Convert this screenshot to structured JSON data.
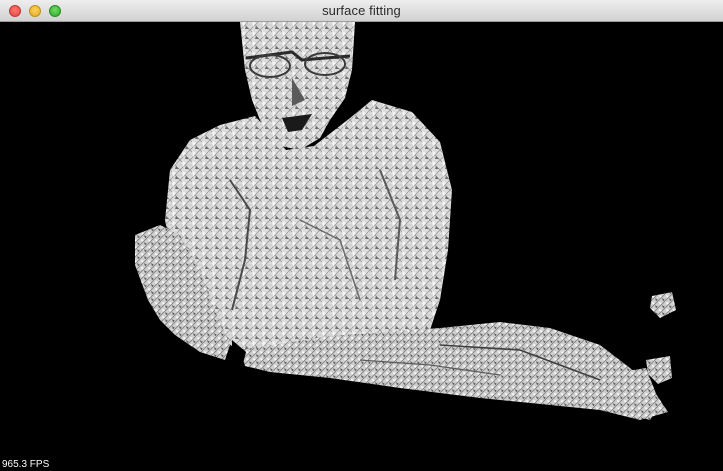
{
  "window": {
    "title": "surface fitting",
    "controls": [
      "close",
      "minimize",
      "zoom"
    ]
  },
  "viewport": {
    "background_color": "#000000",
    "mesh_color": "#e8e8e8",
    "scene": "grayscale 3D surface mesh of a seated person and a table top"
  },
  "overlay": {
    "fps_text": "965.3 FPS"
  }
}
